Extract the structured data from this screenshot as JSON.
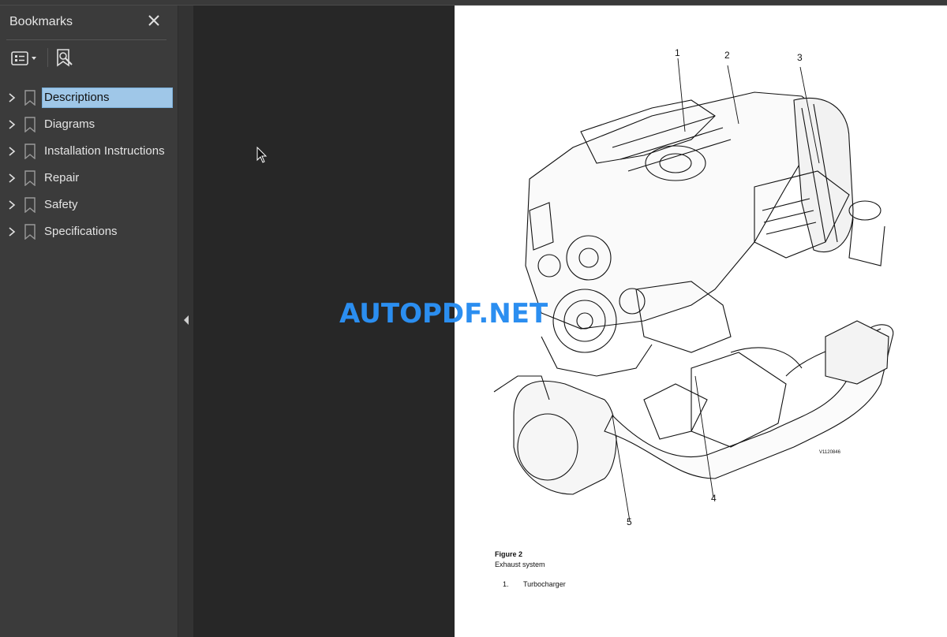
{
  "sidebar": {
    "title": "Bookmarks",
    "close_icon": "close-icon",
    "toolbar": {
      "options_icon": "list-options-icon",
      "find_bookmark_icon": "find-current-bookmark-icon"
    },
    "items": [
      {
        "label": "Descriptions",
        "selected": true
      },
      {
        "label": "Diagrams",
        "selected": false
      },
      {
        "label": "Installation Instructions",
        "selected": false
      },
      {
        "label": "Repair",
        "selected": false
      },
      {
        "label": "Safety",
        "selected": false
      },
      {
        "label": "Specifications",
        "selected": false
      }
    ]
  },
  "watermark": "AUTOPDF.NET",
  "document": {
    "callouts": [
      "1",
      "2",
      "3",
      "4",
      "5"
    ],
    "image_code": "V1120846",
    "figure_title": "Figure 2",
    "figure_caption": "Exhaust system",
    "legend": [
      {
        "number": "1.",
        "text": "Turbocharger"
      }
    ]
  },
  "colors": {
    "sidebar_bg": "#3b3b3b",
    "viewer_bg": "#272727",
    "selection": "#9fc7e8",
    "watermark": "#2b8ef0"
  }
}
